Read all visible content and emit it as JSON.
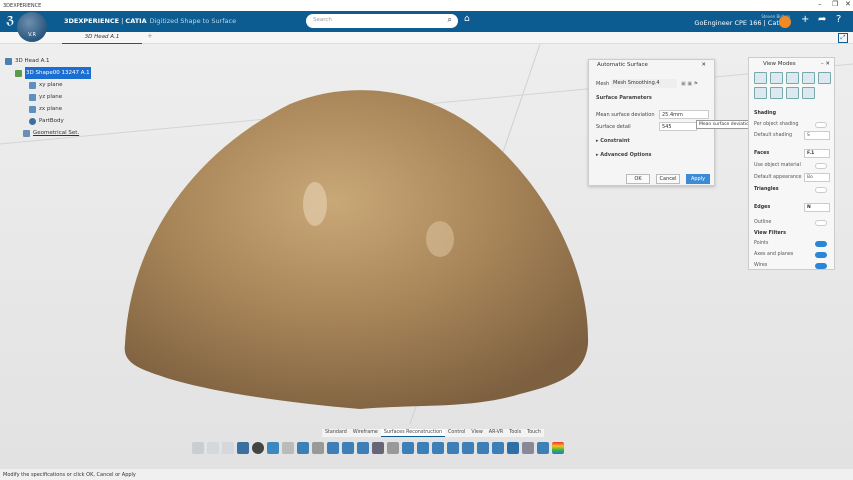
{
  "window": {
    "title": "3DEXPERIENCE",
    "controls": [
      "–",
      "❐",
      "✕"
    ]
  },
  "topbar": {
    "brand": "3DEXPERIENCE",
    "app": "CATIA",
    "app_sub": "Digitized Shape to Surface",
    "compass_label": "V.R",
    "search_placeholder": "Search",
    "user_small": "Steven Bishop",
    "user_main": "GoEngineer CPE 166 | Catia ▾"
  },
  "tabs": {
    "active": "3D Head A.1",
    "add": "+"
  },
  "tree": {
    "root": "3D Head A.1",
    "shape": "3D Shape00 13247 A.1",
    "items": [
      "xy plane",
      "yz plane",
      "zx plane",
      "PartBody",
      "Geometrical Set."
    ]
  },
  "dialog": {
    "title": "Automatic Surface",
    "mesh_label": "Mesh",
    "mesh_value": "Mesh Smoothing.4",
    "section": "Surface Parameters",
    "mean_dev_label": "Mean surface deviation",
    "mean_dev_value": "25.4mm",
    "detail_label": "Surface detail",
    "detail_value": "545",
    "constraint": "Constraint",
    "advanced": "Advanced Options",
    "ok": "OK",
    "cancel": "Cancel",
    "apply": "Apply",
    "tooltip": "Mean surface deviation target"
  },
  "view_modes": {
    "title": "View Modes",
    "shading_hdr": "Shading",
    "per_object": "Per object shading",
    "default_shading": "Default shading",
    "default_shading_val": "S",
    "faces": "Faces",
    "faces_val": "F.1",
    "use_material": "Use object material",
    "default_app": "Default appearance",
    "default_app_val": "Bo",
    "triangles": "Triangles",
    "edges": "Edges",
    "edges_val": "N",
    "outline": "Outline",
    "filters_hdr": "View Filters",
    "points": "Points",
    "axes": "Axes and planes",
    "wires": "Wires",
    "toggles": {
      "per_object": false,
      "use_material": false,
      "triangles": false,
      "outline": false,
      "points": true,
      "axes": true,
      "wires": true
    }
  },
  "action_tabs": [
    "Standard",
    "Wireframe",
    "Surfaces Reconstruction",
    "Control",
    "View",
    "AR-VR",
    "Tools",
    "Touch"
  ],
  "active_action_tab": "Surfaces Reconstruction",
  "model_color": "#a8865a",
  "accent": "#0d5c91",
  "status": "Modify the specifications or click OK, Cancel or Apply"
}
